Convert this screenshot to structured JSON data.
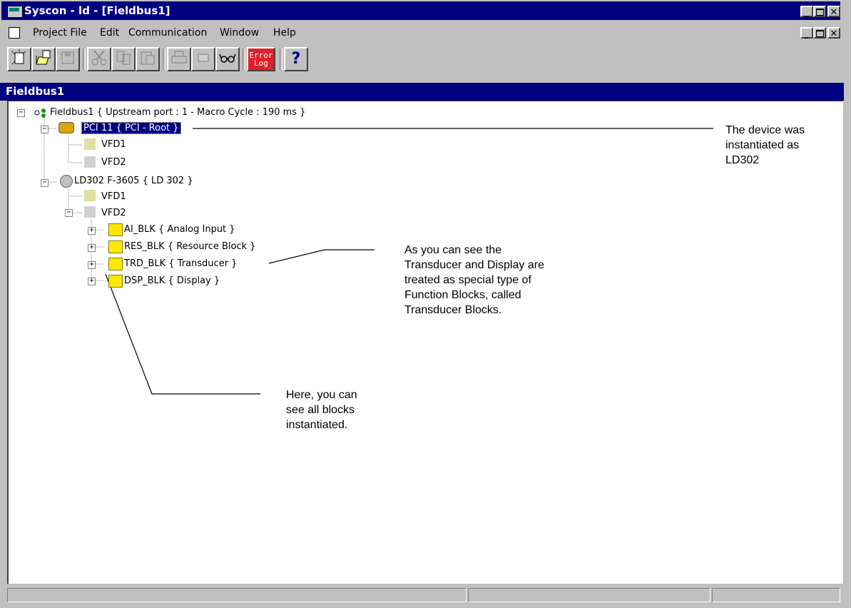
{
  "window": {
    "title": "Syscon - ld - [Fieldbus1]",
    "controls": {
      "minimize": "_",
      "maximize": " ",
      "close": "✕"
    }
  },
  "menu": [
    "Project File",
    "Edit",
    "Communication",
    "Window",
    "Help"
  ],
  "toolbar": {
    "error_log_line1": "Error",
    "error_log_line2": "Log",
    "help_glyph": "?"
  },
  "document": {
    "title": "Fieldbus1"
  },
  "tree": {
    "root": "Fieldbus1 { Upstream port : 1 -  Macro Cycle : 190 ms  }",
    "pci": "PCI 11 { PCI - Root }",
    "pci_vfd1": "VFD1",
    "pci_vfd2": "VFD2",
    "ld302": "LD302 F-3605 { LD 302 }",
    "ld_vfd1": "VFD1",
    "ld_vfd2": "VFD2",
    "blocks": [
      "AI_BLK { Analog Input }",
      "RES_BLK { Resource Block }",
      "TRD_BLK { Transducer }",
      "DSP_BLK { Display }"
    ]
  },
  "annotations": {
    "device": [
      "The device was",
      "instantiated as",
      "LD302"
    ],
    "transducer": [
      "As you can see the",
      "Transducer and Display are",
      "treated as special type of",
      "Function Blocks, called",
      "Transducer Blocks."
    ],
    "blocks": [
      "Here, you can",
      "see all blocks",
      "instantiated."
    ]
  }
}
